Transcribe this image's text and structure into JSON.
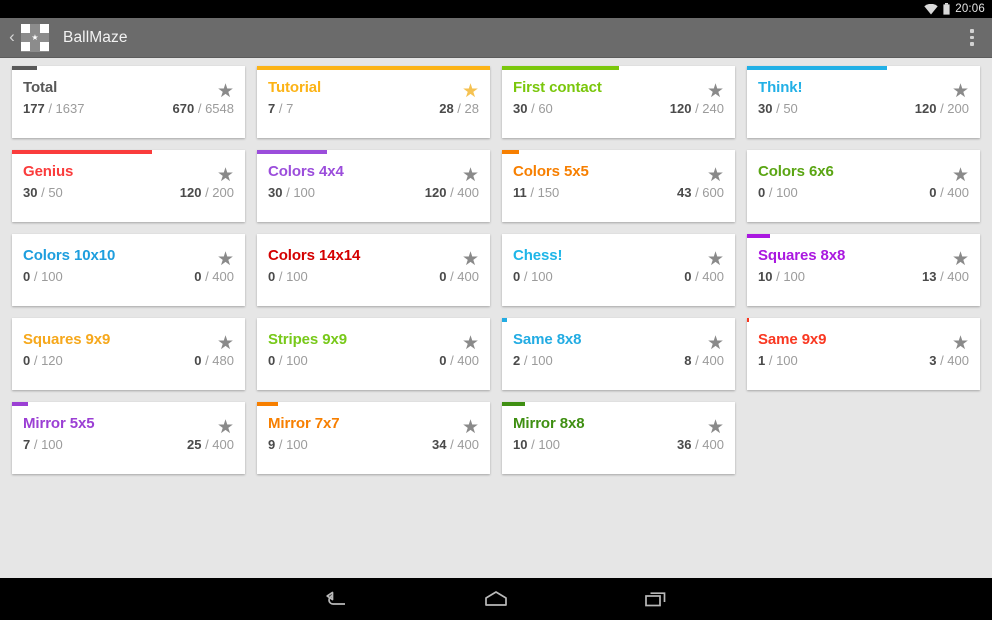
{
  "status_bar": {
    "clock": "20:06",
    "wifi_icon": "wifi-icon",
    "battery_icon": "battery-icon"
  },
  "action_bar": {
    "up_caret": "‹",
    "app_icon": "ballmaze-checkerboard-star-icon",
    "title": "BallMaze",
    "overflow_label": "overflow-menu"
  },
  "navigation_bar": {
    "back": "back-icon",
    "home": "home-icon",
    "recents": "recents-icon"
  },
  "colors": {
    "background": "#e6e6e6",
    "card": "#ffffff",
    "action_bar": "#6b6b6b",
    "star_earned": "#f5c252",
    "star_empty": "#8a8a8a"
  },
  "cards": [
    {
      "title": "Total",
      "color": "#585858",
      "progress_pct": 10.8,
      "levels_done": "177",
      "levels_total": "1637",
      "stars_done": "670",
      "stars_total": "6548",
      "star_filled": false
    },
    {
      "title": "Tutorial",
      "color": "#fcb316",
      "progress_pct": 100,
      "levels_done": "7",
      "levels_total": "7",
      "stars_done": "28",
      "stars_total": "28",
      "star_filled": true
    },
    {
      "title": "First contact",
      "color": "#7ac70c",
      "progress_pct": 50,
      "levels_done": "30",
      "levels_total": "60",
      "stars_done": "120",
      "stars_total": "240",
      "star_filled": false
    },
    {
      "title": "Think!",
      "color": "#22b0e6",
      "progress_pct": 60,
      "levels_done": "30",
      "levels_total": "50",
      "stars_done": "120",
      "stars_total": "200",
      "star_filled": false
    },
    {
      "title": "Genius",
      "color": "#fa3c3c",
      "progress_pct": 60,
      "levels_done": "30",
      "levels_total": "50",
      "stars_done": "120",
      "stars_total": "200",
      "star_filled": false
    },
    {
      "title": "Colors 4x4",
      "color": "#9b4ddb",
      "progress_pct": 30,
      "levels_done": "30",
      "levels_total": "100",
      "stars_done": "120",
      "stars_total": "400",
      "star_filled": false
    },
    {
      "title": "Colors 5x5",
      "color": "#f77f00",
      "progress_pct": 7.3,
      "levels_done": "11",
      "levels_total": "150",
      "stars_done": "43",
      "stars_total": "600",
      "star_filled": false
    },
    {
      "title": "Colors 6x6",
      "color": "#5aa513",
      "progress_pct": 0,
      "levels_done": "0",
      "levels_total": "100",
      "stars_done": "0",
      "stars_total": "400",
      "star_filled": false
    },
    {
      "title": "Colors 10x10",
      "color": "#1e9ede",
      "progress_pct": 0,
      "levels_done": "0",
      "levels_total": "100",
      "stars_done": "0",
      "stars_total": "400",
      "star_filled": false
    },
    {
      "title": "Colors 14x14",
      "color": "#d40000",
      "progress_pct": 0,
      "levels_done": "0",
      "levels_total": "100",
      "stars_done": "0",
      "stars_total": "400",
      "star_filled": false
    },
    {
      "title": "Chess!",
      "color": "#1fb6e8",
      "progress_pct": 0,
      "levels_done": "0",
      "levels_total": "100",
      "stars_done": "0",
      "stars_total": "400",
      "star_filled": false
    },
    {
      "title": "Squares 8x8",
      "color": "#aa18e0",
      "progress_pct": 10,
      "levels_done": "10",
      "levels_total": "100",
      "stars_done": "13",
      "stars_total": "400",
      "star_filled": false
    },
    {
      "title": "Squares 9x9",
      "color": "#f6a81c",
      "progress_pct": 0,
      "levels_done": "0",
      "levels_total": "120",
      "stars_done": "0",
      "stars_total": "480",
      "star_filled": false
    },
    {
      "title": "Stripes 9x9",
      "color": "#78c91a",
      "progress_pct": 0,
      "levels_done": "0",
      "levels_total": "100",
      "stars_done": "0",
      "stars_total": "400",
      "star_filled": false
    },
    {
      "title": "Same 8x8",
      "color": "#23ace3",
      "progress_pct": 2,
      "levels_done": "2",
      "levels_total": "100",
      "stars_done": "8",
      "stars_total": "400",
      "star_filled": false
    },
    {
      "title": "Same 9x9",
      "color": "#f93822",
      "progress_pct": 1,
      "levels_done": "1",
      "levels_total": "100",
      "stars_done": "3",
      "stars_total": "400",
      "star_filled": false
    },
    {
      "title": "Mirror 5x5",
      "color": "#9b3fd4",
      "progress_pct": 7,
      "levels_done": "7",
      "levels_total": "100",
      "stars_done": "25",
      "stars_total": "400",
      "star_filled": false
    },
    {
      "title": "Mirror 7x7",
      "color": "#f77f00",
      "progress_pct": 9,
      "levels_done": "9",
      "levels_total": "100",
      "stars_done": "34",
      "stars_total": "400",
      "star_filled": false
    },
    {
      "title": "Mirror 8x8",
      "color": "#3f8f12",
      "progress_pct": 10,
      "levels_done": "10",
      "levels_total": "100",
      "stars_done": "36",
      "stars_total": "400",
      "star_filled": false
    }
  ]
}
